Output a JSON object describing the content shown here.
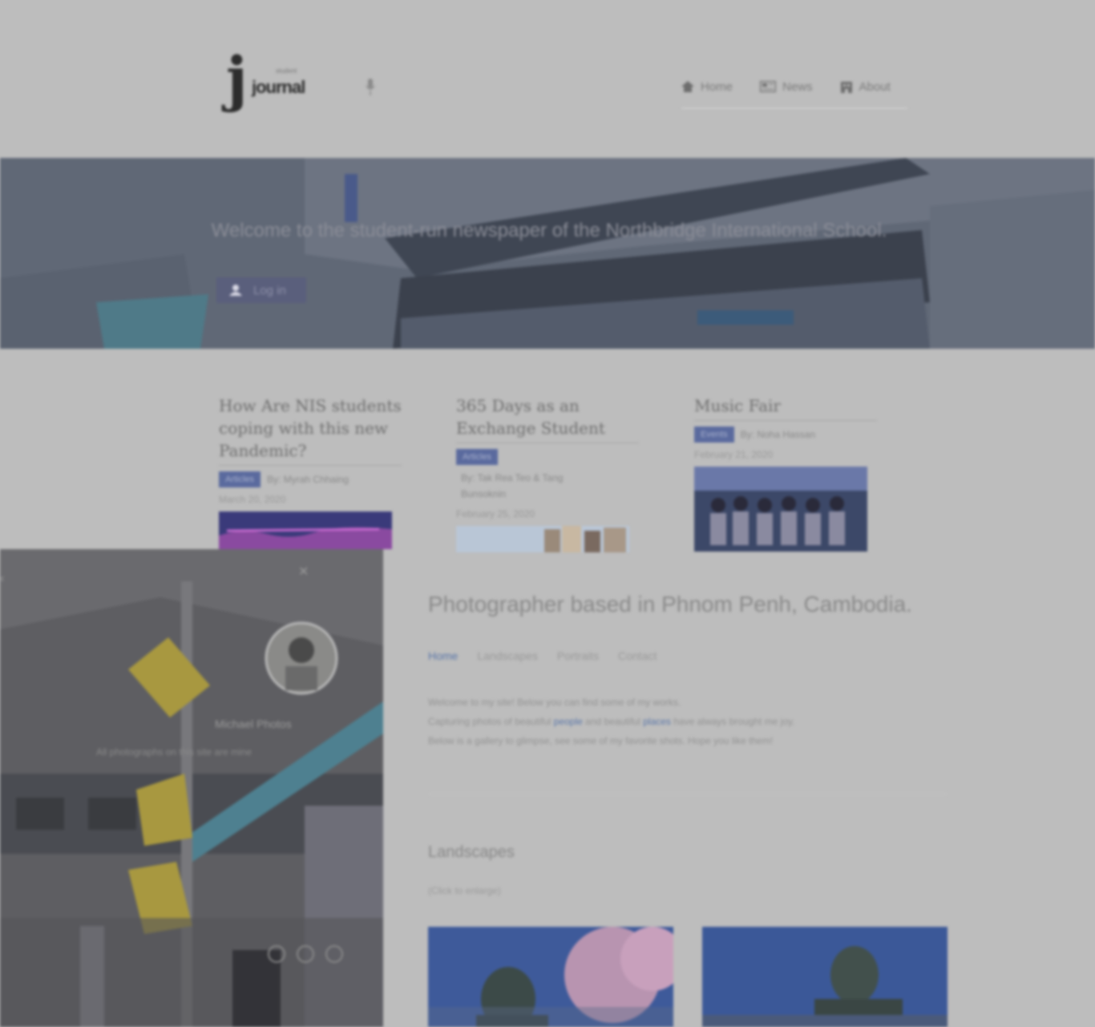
{
  "header": {
    "logo_letter": "j",
    "logo_word": "journal",
    "logo_tag": "student",
    "nav": [
      {
        "label": "Home",
        "icon": "home-icon"
      },
      {
        "label": "News",
        "icon": "news-icon"
      },
      {
        "label": "About",
        "icon": "building-icon"
      }
    ]
  },
  "hero": {
    "text": "Welcome to the student-run newspaper of the Northbridge International School.",
    "login_label": "Log in",
    "login_icon": "user-icon"
  },
  "articles": [
    {
      "title": "How Are NIS students coping with this new Pandemic?",
      "category": "Articles",
      "byline": "By: Myrah Chhaing",
      "date": "March 20, 2020"
    },
    {
      "title": "365 Days as an Exchange Student",
      "category": "Articles",
      "byline": "By: Tak Rea Teo & Tang Bunsoknin",
      "date": "February 25, 2020"
    },
    {
      "title": "Music Fair",
      "category": "Events",
      "byline": "By: Noha Hassan",
      "date": "February 21, 2020"
    }
  ],
  "panel": {
    "name": "Michael Photos",
    "subtitle": "All photographs on this site are mine"
  },
  "portfolio": {
    "tagline": "Photographer based in Phnom Penh, Cambodia.",
    "tabs": [
      "Home",
      "Landscapes",
      "Portraits",
      "Contact"
    ],
    "intro_line1": "Welcome to my site! Below you can find some of my works.",
    "intro_line2_pre": "Capturing photos of beautiful ",
    "intro_link1": "people",
    "intro_line2_mid": " and beautiful ",
    "intro_link2": "places",
    "intro_line2_post": " have always brought me joy.",
    "intro_line3": "Below is a gallery to glimpse, see some of my favorite shots. Hope you like them!",
    "section_title": "Landscapes",
    "section_sub": "(Click to enlarge)"
  },
  "colors": {
    "accent": "#5a6a9e",
    "link": "#5a76a8",
    "background": "#bdbdbd"
  }
}
